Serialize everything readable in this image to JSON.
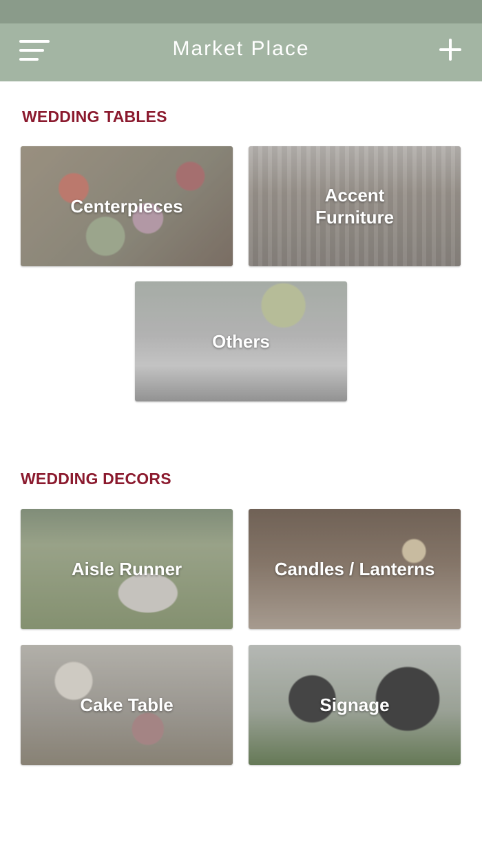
{
  "navbar": {
    "title": "Market Place",
    "menu_icon": "menu-icon",
    "add_icon": "plus-icon"
  },
  "sections": [
    {
      "title": "WEDDING TABLES",
      "tiles": [
        {
          "label": "Centerpieces"
        },
        {
          "label": "Accent\nFurniture"
        },
        {
          "label": "Others"
        }
      ]
    },
    {
      "title": "WEDDING DECORS",
      "tiles": [
        {
          "label": "Aisle Runner"
        },
        {
          "label": "Candles / Lanterns"
        },
        {
          "label": "Cake Table"
        },
        {
          "label": "Signage"
        }
      ]
    }
  ],
  "colors": {
    "navbar": "#a3b5a3",
    "statusbar": "#8a9b8a",
    "section_title": "#8b1a2e"
  }
}
